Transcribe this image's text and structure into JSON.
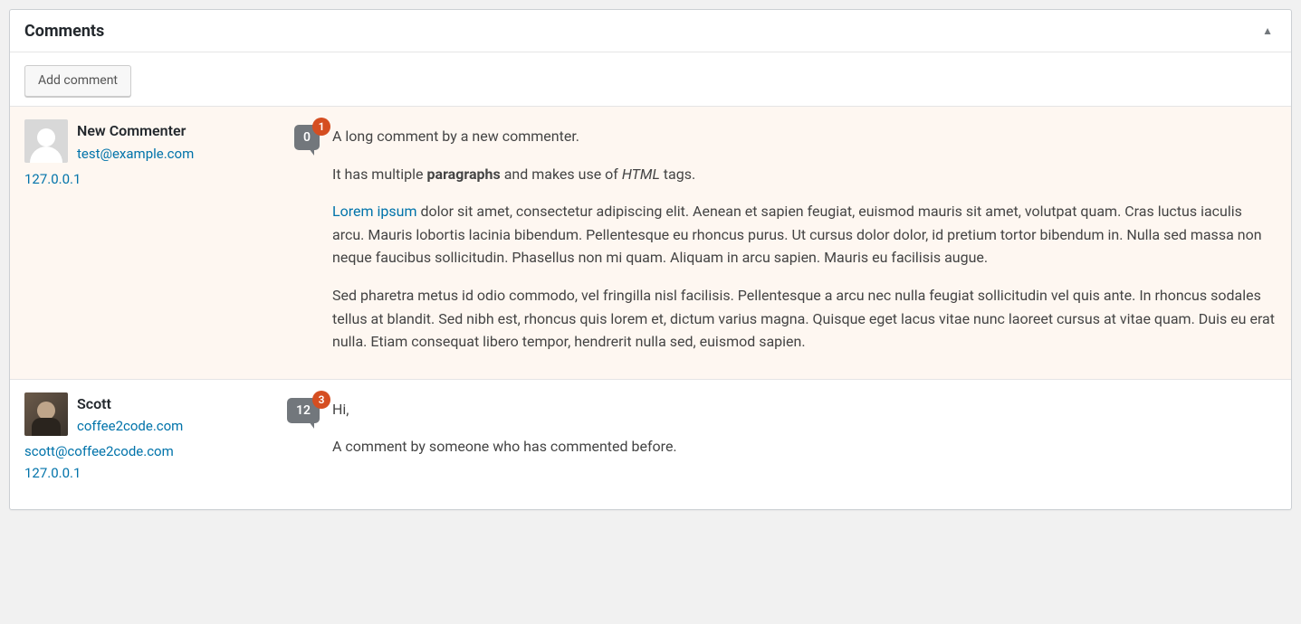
{
  "panel": {
    "title": "Comments",
    "add_comment_label": "Add comment"
  },
  "comments": [
    {
      "status": "unapproved",
      "author": {
        "name": "New Commenter",
        "email": "test@example.com",
        "website": "",
        "ip": "127.0.0.1",
        "avatar_kind": "mystery"
      },
      "counts": {
        "approved": "0",
        "pending": "1"
      },
      "body": [
        {
          "type": "p",
          "runs": [
            {
              "text": "A long comment by a new commenter."
            }
          ]
        },
        {
          "type": "p",
          "runs": [
            {
              "text": "It has multiple "
            },
            {
              "text": "paragraphs",
              "strong": true
            },
            {
              "text": " and makes use of "
            },
            {
              "text": "HTML",
              "italic": true
            },
            {
              "text": " tags."
            }
          ]
        },
        {
          "type": "p",
          "runs": [
            {
              "text": "Lorem ipsum",
              "link": true
            },
            {
              "text": " dolor sit amet, consectetur adipiscing elit. Aenean et sapien feugiat, euismod mauris sit amet, volutpat quam. Cras luctus iaculis arcu. Mauris lobortis lacinia bibendum. Pellentesque eu rhoncus purus. Ut cursus dolor dolor, id pretium tortor bibendum in. Nulla sed massa non neque faucibus sollicitudin. Phasellus non mi quam. Aliquam in arcu sapien. Mauris eu facilisis augue."
            }
          ]
        },
        {
          "type": "p",
          "runs": [
            {
              "text": "Sed pharetra metus id odio commodo, vel fringilla nisl facilisis. Pellentesque a arcu nec nulla feugiat sollicitudin vel quis ante. In rhoncus sodales tellus at blandit. Sed nibh est, rhoncus quis lorem et, dictum varius magna. Quisque eget lacus vitae nunc laoreet cursus at vitae quam. Duis eu erat nulla. Etiam consequat libero tempor, hendrerit nulla sed, euismod sapien."
            }
          ]
        }
      ]
    },
    {
      "status": "approved",
      "author": {
        "name": "Scott",
        "email": "scott@coffee2code.com",
        "website": "coffee2code.com",
        "ip": "127.0.0.1",
        "avatar_kind": "photo"
      },
      "counts": {
        "approved": "12",
        "pending": "3"
      },
      "body": [
        {
          "type": "p",
          "runs": [
            {
              "text": "Hi,"
            }
          ]
        },
        {
          "type": "p",
          "runs": [
            {
              "text": "A comment by someone who has commented before."
            }
          ]
        }
      ]
    }
  ]
}
